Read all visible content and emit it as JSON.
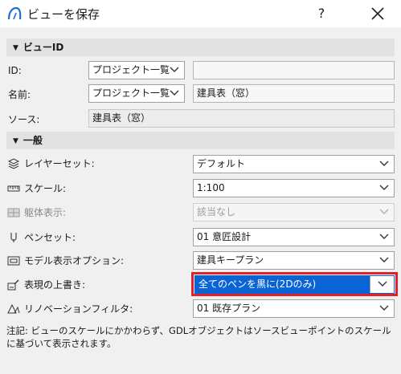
{
  "window": {
    "title": "ビューを保存",
    "help_label": "?"
  },
  "view_id_section": {
    "header": "ビューID",
    "id_label": "ID:",
    "id_source_value": "プロジェクト一覧",
    "id_value": "",
    "name_label": "名前:",
    "name_source_value": "プロジェクト一覧",
    "name_value": "建具表（窓）",
    "source_label": "ソース:",
    "source_value": "建具表（窓）"
  },
  "general_section": {
    "header": "一般",
    "rows": [
      {
        "label": "レイヤーセット:",
        "value": "デフォルト",
        "icon": "layers-icon",
        "enabled": true
      },
      {
        "label": "スケール:",
        "value": "1:100",
        "icon": "scale-ruler-icon",
        "enabled": true
      },
      {
        "label": "躯体表示:",
        "value": "該当なし",
        "icon": "structure-display-icon",
        "enabled": false
      },
      {
        "label": "ペンセット:",
        "value": "01 意匠設計",
        "icon": "pen-nib-icon",
        "enabled": true
      },
      {
        "label": "モデル表示オプション:",
        "value": "建具キープラン",
        "icon": "model-display-icon",
        "enabled": true
      },
      {
        "label": "表現の上書き:",
        "value": "全てのペンを黒に(2Dのみ)",
        "icon": "graphic-override-icon",
        "enabled": true,
        "highlighted": true
      },
      {
        "label": "リノベーションフィルタ:",
        "value": "01 既存プラン",
        "icon": "renovation-filter-icon",
        "enabled": true
      }
    ]
  },
  "note": "注記: ビューのスケールにかかわらず、GDLオブジェクトはソースビューポイントのスケールに基づいて表示されます。",
  "colors": {
    "highlight": "#e0202b",
    "selection": "#0a64d6"
  }
}
